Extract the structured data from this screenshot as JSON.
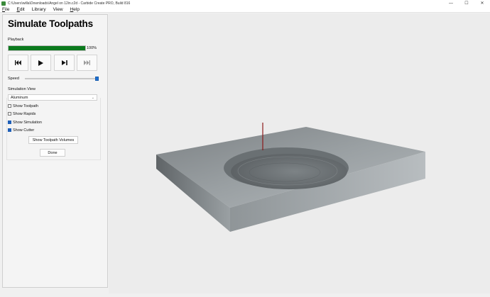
{
  "window": {
    "title": "C:\\Users\\willa\\Downloads\\Angel on 12in.c2d - Carbide Create PRO, Build 816",
    "controls": {
      "minimize": "—",
      "maximize": "☐",
      "close": "✕"
    }
  },
  "menu": {
    "items": [
      {
        "u": "F",
        "rest": "ile"
      },
      {
        "u": "E",
        "rest": "dit"
      },
      {
        "u": "",
        "rest": "Library"
      },
      {
        "u": "",
        "rest": "View"
      },
      {
        "u": "H",
        "rest": "elp"
      }
    ]
  },
  "panel": {
    "title": "Simulate Toolpaths",
    "playback_label": "Playback",
    "progress_percent": 100,
    "progress_text": "100%",
    "buttons": {
      "rewind": "rewind-icon",
      "play": "play-icon",
      "step_end": "step-end-icon",
      "fast_forward": "fast-forward-icon"
    },
    "speed_label": "Speed",
    "speed_level": 1.0,
    "simulation_view_label": "Simulation View",
    "material_selected": "Aluminum",
    "checkboxes": [
      {
        "label": "Show Toolpath",
        "checked": false
      },
      {
        "label": "Show Rapids",
        "checked": false
      },
      {
        "label": "Show Simulation",
        "checked": true
      },
      {
        "label": "Show Cutter",
        "checked": true
      }
    ],
    "volumes_button": "Show Toolpath Volumes",
    "done_button": "Done"
  },
  "colors": {
    "progress_fill": "#0b7a1d",
    "accent": "#1f5fb8",
    "stock": "#8d9396",
    "cutter": "#8b1a1a"
  }
}
